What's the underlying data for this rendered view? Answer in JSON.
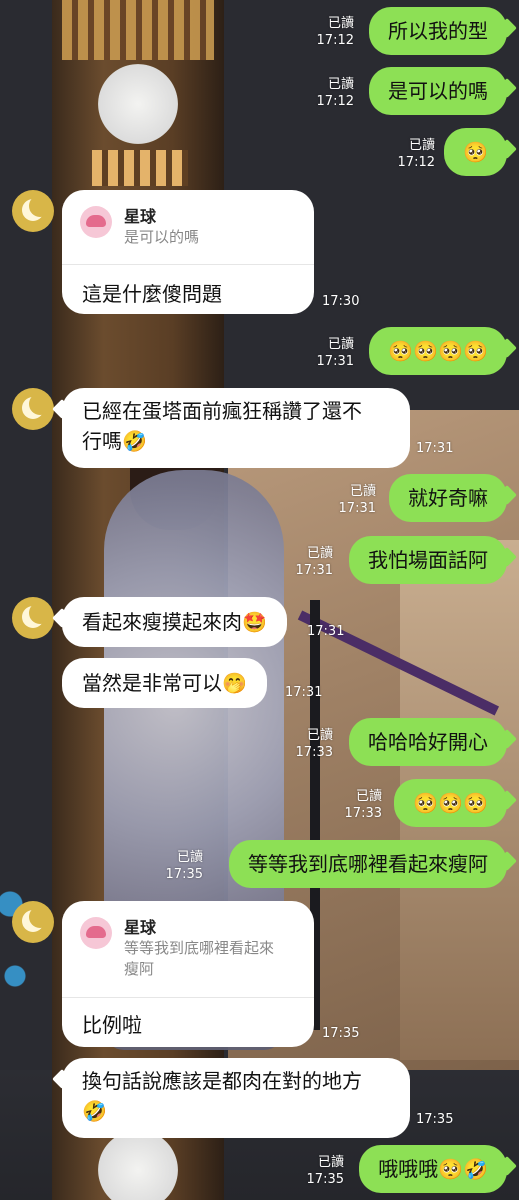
{
  "theme": {
    "bubble_out": "#8de055",
    "bubble_in": "#ffffff",
    "meta_text": "#ffffff",
    "avatar_bg": "#d8b648"
  },
  "read_label": "已讀",
  "messages": [
    {
      "side": "out",
      "text": "所以我的型",
      "time": "17:12"
    },
    {
      "side": "out",
      "text": "是可以的嗎",
      "time": "17:12"
    },
    {
      "side": "out",
      "text": "🥺",
      "time": "17:12"
    },
    {
      "side": "in",
      "reply_to": {
        "name": "星球",
        "text": "是可以的嗎"
      },
      "text": "這是什麼傻問題",
      "time": "17:30"
    },
    {
      "side": "out",
      "text": "🥺🥺🥺🥺",
      "time": "17:31"
    },
    {
      "side": "in",
      "text_lines": [
        "已經在蛋塔面前瘋狂稱讚了還不",
        "行嗎🤣"
      ],
      "time": "17:31"
    },
    {
      "side": "out",
      "text": "就好奇嘛",
      "time": "17:31"
    },
    {
      "side": "out",
      "text": "我怕場面話阿",
      "time": "17:31"
    },
    {
      "side": "in",
      "text": "看起來瘦摸起來肉🤩",
      "time": "17:31"
    },
    {
      "side": "in",
      "text": "當然是非常可以🤭",
      "time": "17:31"
    },
    {
      "side": "out",
      "text": "哈哈哈好開心",
      "time": "17:33"
    },
    {
      "side": "out",
      "text": "🥺🥺🥺",
      "time": "17:33"
    },
    {
      "side": "out",
      "text": "等等我到底哪裡看起來瘦阿",
      "time": "17:35"
    },
    {
      "side": "in",
      "reply_to": {
        "name": "星球",
        "text_lines": [
          "等等我到底哪裡看起來",
          "瘦阿"
        ]
      },
      "text": "比例啦",
      "time": "17:35"
    },
    {
      "side": "in",
      "text_lines": [
        "換句話說應該是都肉在對的地方",
        "🤣"
      ],
      "time": "17:35"
    },
    {
      "side": "out",
      "text": "哦哦哦🥺🤣",
      "time": "17:35"
    }
  ]
}
